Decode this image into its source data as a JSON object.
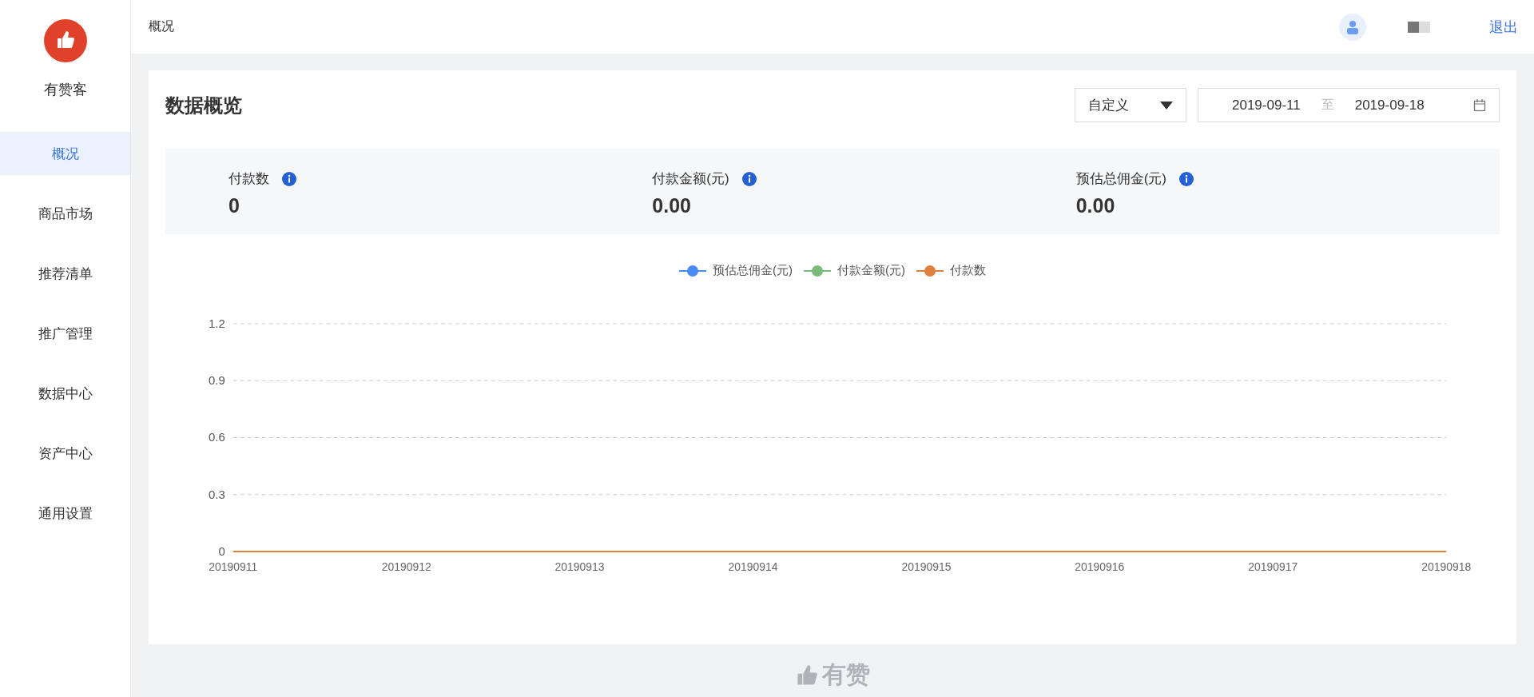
{
  "brand": {
    "name": "有赞客"
  },
  "sidebar": {
    "items": [
      {
        "label": "概况",
        "selected": true
      },
      {
        "label": "商品市场",
        "selected": false
      },
      {
        "label": "推荐清单",
        "selected": false
      },
      {
        "label": "推广管理",
        "selected": false
      },
      {
        "label": "数据中心",
        "selected": false
      },
      {
        "label": "资产中心",
        "selected": false
      },
      {
        "label": "通用设置",
        "selected": false
      }
    ]
  },
  "header": {
    "breadcrumb": "概况",
    "logout": "退出"
  },
  "card": {
    "title": "数据概览",
    "range_select": "自定义",
    "date_start": "2019-09-11",
    "date_separator": "至",
    "date_end": "2019-09-18"
  },
  "stats": [
    {
      "label": "付款数",
      "value": "0"
    },
    {
      "label": "付款金额(元)",
      "value": "0.00"
    },
    {
      "label": "预估总佣金(元)",
      "value": "0.00"
    }
  ],
  "chart_data": {
    "type": "line",
    "grid": true,
    "categories": [
      "20190911",
      "20190912",
      "20190913",
      "20190914",
      "20190915",
      "20190916",
      "20190917",
      "20190918"
    ],
    "ylim": [
      0,
      1.2
    ],
    "yticks": [
      0,
      0.3,
      0.6,
      0.9,
      1.2
    ],
    "series": [
      {
        "name": "预估总佣金(元)",
        "color": "#4a8af4",
        "values": [
          null,
          null,
          null,
          null,
          null,
          null,
          null,
          null
        ]
      },
      {
        "name": "付款金额(元)",
        "color": "#7cba7c",
        "values": [
          null,
          null,
          null,
          null,
          null,
          null,
          null,
          null
        ]
      },
      {
        "name": "付款数",
        "color": "#e0803e",
        "values": [
          0,
          0,
          0,
          0,
          0,
          0,
          0,
          0
        ]
      }
    ]
  },
  "footer": {
    "brand": "有赞"
  }
}
